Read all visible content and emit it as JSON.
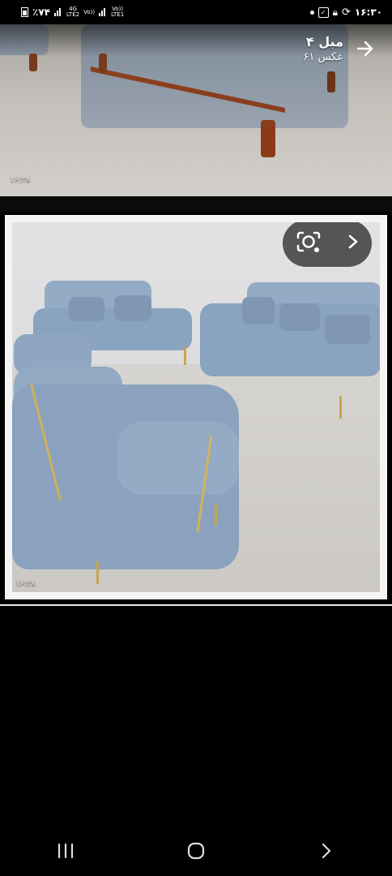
{
  "status_bar": {
    "battery": "٪۷۴",
    "net_1": "4G",
    "net_1_sub": "LTE2",
    "volte_1": "Vo))",
    "volte_2": "Vo))",
    "net_2": "LTE1",
    "time": "۱۶:۳۰"
  },
  "album": {
    "title": "مبل ۴",
    "count": "۶۱ عکس"
  },
  "photos": [
    {
      "timestamp": "۱۶:۲۸"
    },
    {
      "timestamp": "۱۶:۲۸"
    }
  ],
  "icons": {
    "album_forward": "arrow-right-icon",
    "lens": "google-lens-icon",
    "lens_next": "chevron-right-icon",
    "nav_recents": "recents-icon",
    "nav_home": "home-icon",
    "nav_back": "back-icon"
  },
  "colors": {
    "background": "#000000",
    "sofa_fabric": "#8ca6c2",
    "pill": "#3c3c3c"
  }
}
